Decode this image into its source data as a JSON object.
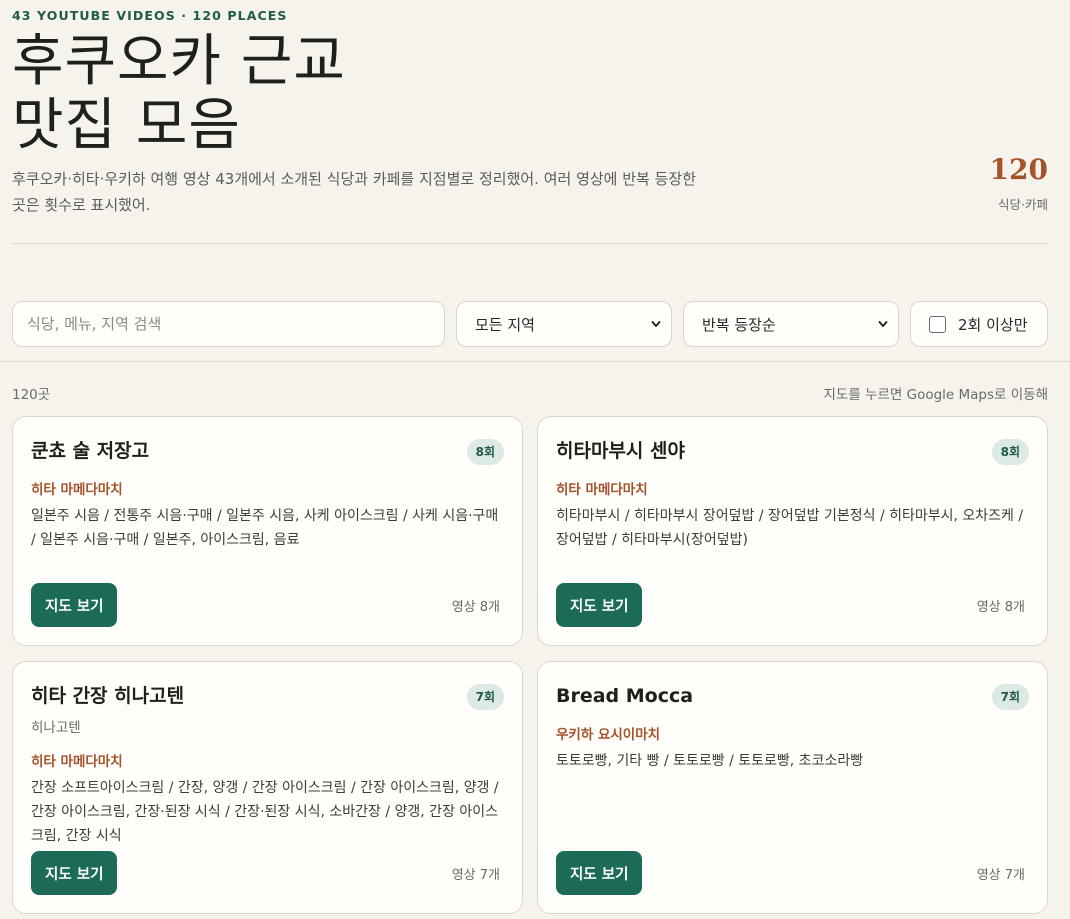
{
  "header": {
    "eyebrow": "43 YOUTUBE VIDEOS · 120 PLACES",
    "title_line1": "후쿠오카 근교",
    "title_line2": "맛집 모음",
    "intro": "후쿠오카·히타·우키하 여행 영상 43개에서 소개된 식당과 카페를 지점별로 정리했어. 여러 영상에 반복 등장한 곳은 횟수로 표시했어.",
    "stat_value": "120",
    "stat_label": "식당·카페"
  },
  "filters": {
    "search_placeholder": "식당, 메뉴, 지역 검색",
    "region_selected": "모든 지역",
    "sort_selected": "반복 등장순",
    "repeat_only_label": "2회 이상만",
    "repeat_only_checked": false
  },
  "results": {
    "count_label": "120곳",
    "map_hint": "지도를 누르면 Google Maps로 이동해"
  },
  "cards": [
    {
      "name": "쿤쵸 술 저장고",
      "subname": "",
      "badge": "8회",
      "area": "히타 마메다마치",
      "menus": "일본주 시음 / 전통주 시음·구매 / 일본주 시음, 사케 아이스크림 / 사케 시음·구매 / 일본주 시음·구매 / 일본주, 아이스크림, 음료",
      "button": "지도 보기",
      "videos": "영상 8개"
    },
    {
      "name": "히타마부시 센야",
      "subname": "",
      "badge": "8회",
      "area": "히타 마메다마치",
      "menus": "히타마부시 / 히타마부시 장어덮밥 / 장어덮밥 기본정식 / 히타마부시, 오차즈케 / 장어덮밥 / 히타마부시(장어덮밥)",
      "button": "지도 보기",
      "videos": "영상 8개"
    },
    {
      "name": "히타 간장 히나고텐",
      "subname": "히나고텐",
      "badge": "7회",
      "area": "히타 마메다마치",
      "menus": "간장 소프트아이스크림 / 간장, 양갱 / 간장 아이스크림 / 간장 아이스크림, 양갱 / 간장 아이스크림, 간장·된장 시식 / 간장·된장 시식, 소바간장 / 양갱, 간장 아이스크림, 간장 시식",
      "button": "지도 보기",
      "videos": "영상 7개"
    },
    {
      "name": "Bread Mocca",
      "subname": "",
      "badge": "7회",
      "area": "우키하 요시이마치",
      "menus": "토토로빵, 기타 빵 / 토토로빵 / 토토로빵, 초코소라빵",
      "button": "지도 보기",
      "videos": "영상 7개"
    }
  ],
  "colors": {
    "background": "#f6f3ec",
    "accent_green": "#1c6b56",
    "accent_brown": "#a5532a",
    "badge_bg": "#dde9e3"
  }
}
